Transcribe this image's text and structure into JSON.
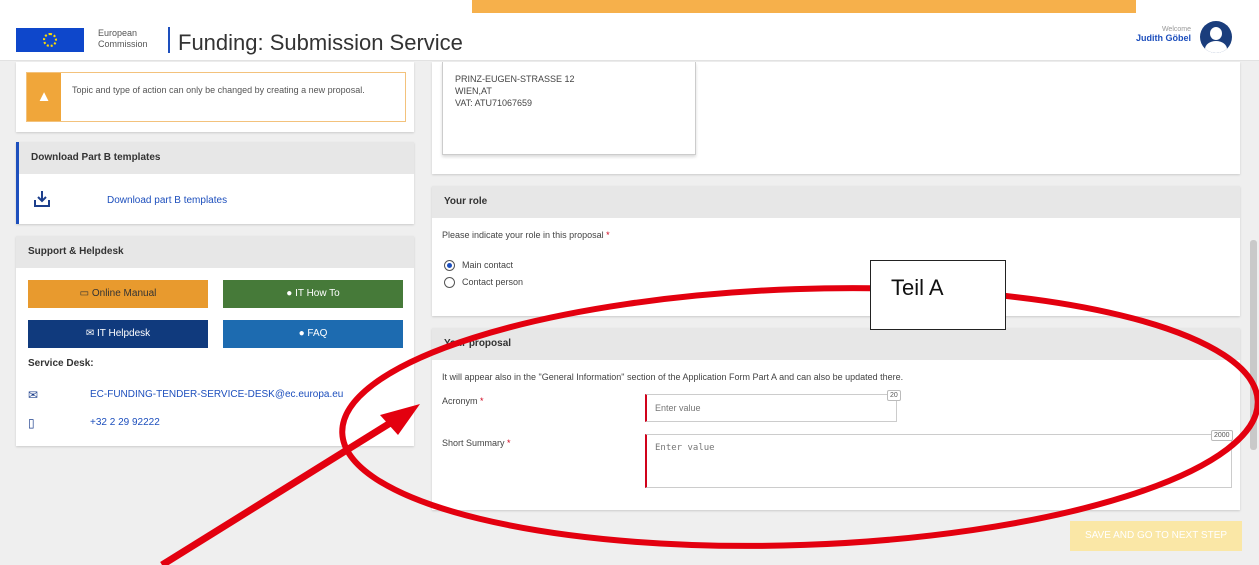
{
  "header": {
    "ec_line1": "European",
    "ec_line2": "Commission",
    "app_title": "Funding: Submission Service",
    "welcome_label": "Welcome",
    "user_name": "Judith Göbel",
    "accent_color": "#f6b04b"
  },
  "sidebar": {
    "warning_text": "Topic and type of action can only be changed by creating a new proposal.",
    "templates": {
      "title": "Download Part B templates",
      "link": "Download part B templates"
    },
    "support": {
      "title": "Support & Helpdesk",
      "buttons": {
        "online_manual": "Online Manual",
        "it_how_to": "IT How To",
        "it_helpdesk": "IT Helpdesk",
        "faq": "FAQ"
      },
      "service_desk_label": "Service Desk:",
      "email": "EC-FUNDING-TENDER-SERVICE-DESK@ec.europa.eu",
      "phone": "+32 2 29 92222"
    }
  },
  "address": {
    "street": "PRINZ-EUGEN-STRASSE 12",
    "city": "WIEN,AT",
    "vat": "VAT: ATU71067659"
  },
  "role": {
    "title": "Your role",
    "prompt": "Please indicate your role in this proposal",
    "options": [
      "Main contact",
      "Contact person"
    ],
    "selected": "Main contact"
  },
  "proposal": {
    "title": "Your proposal",
    "info": "It will appear also in the \"General Information\" section of the Application Form Part A and can also be updated there.",
    "acronym_label": "Acronym",
    "acronym_placeholder": "Enter value",
    "acronym_max": "20",
    "summary_label": "Short Summary",
    "summary_placeholder": "Enter value",
    "summary_max": "2000"
  },
  "footer": {
    "next_button": "SAVE AND GO TO NEXT STEP"
  },
  "annotation": {
    "label": "Teil A",
    "color": "#e3000f"
  }
}
